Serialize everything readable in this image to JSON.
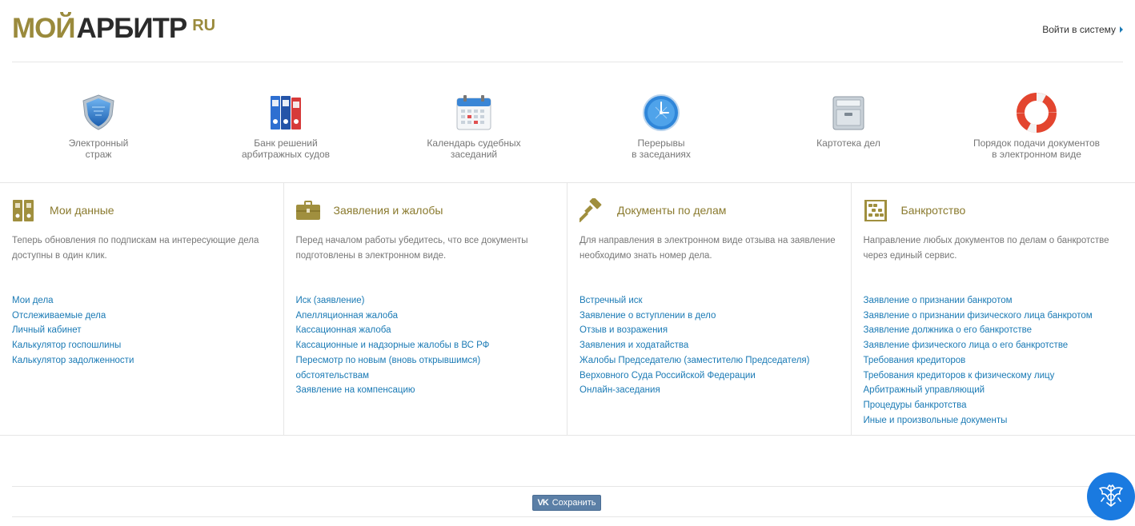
{
  "header": {
    "logo_part1": "МОЙ",
    "logo_part2": "АРБИТР",
    "logo_part3": "RU",
    "login_label": "Войти в систему"
  },
  "services": [
    {
      "icon": "shield-icon",
      "line1": "Электронный",
      "line2": "страж"
    },
    {
      "icon": "binders-icon",
      "line1": "Банк решений",
      "line2": "арбитражных судов"
    },
    {
      "icon": "calendar-icon",
      "line1": "Календарь судебных",
      "line2": "заседаний"
    },
    {
      "icon": "clock-icon",
      "line1": "Перерывы",
      "line2": "в заседаниях"
    },
    {
      "icon": "cabinet-icon",
      "line1": "Картотека дел",
      "line2": ""
    },
    {
      "icon": "lifebuoy-icon",
      "line1": "Порядок подачи документов",
      "line2": "в электронном виде"
    }
  ],
  "columns": [
    {
      "icon": "folders-icon",
      "title": "Мои данные",
      "desc1": "Теперь обновления по подпискам на интересующие дела",
      "desc2": "доступны в один клик.",
      "links": [
        "Мои дела",
        "Отслеживаемые дела",
        "Личный кабинет",
        "Калькулятор госпошлины",
        "Калькулятор задолженности"
      ]
    },
    {
      "icon": "briefcase-icon",
      "title": "Заявления и жалобы",
      "desc1": "Перед началом работы убедитесь, что все документы",
      "desc2": "подготовлены в электронном виде.",
      "links": [
        "Иск (заявление)",
        "Апелляционная жалоба",
        "Кассационная жалоба",
        "Кассационные и надзорные жалобы в ВС РФ",
        "Пересмотр по новым (вновь открывшимся)",
        "обстоятельствам",
        "Заявление на компенсацию"
      ]
    },
    {
      "icon": "gavel-icon",
      "title": "Документы по делам",
      "desc1": "Для направления в электронном виде отзыва на заявление",
      "desc2": "необходимо знать номер дела.",
      "links": [
        "Встречный иск",
        "Заявление о вступлении в дело",
        "Отзыв и возражения",
        "Заявления и ходатайства",
        "Жалобы Председателю (заместителю Председателя)",
        "Верховного Суда Российской Федерации",
        "Онлайн-заседания"
      ]
    },
    {
      "icon": "abacus-icon",
      "title": "Банкротство",
      "desc1": "Направление любых документов по делам о банкротстве",
      "desc2": "через единый сервис.",
      "links": [
        "Заявление о признании банкротом",
        "Заявление о признании физического лица банкротом",
        "Заявление должника о его банкротстве",
        "Заявление физического лица о его банкротстве",
        "Требования кредиторов",
        "Требования кредиторов к физическому лицу",
        "Арбитражный управляющий",
        "Процедуры банкротства",
        "Иные и произвольные документы"
      ]
    }
  ],
  "footer": {
    "vk_icon": "VK",
    "vk_label": "Сохранить"
  }
}
